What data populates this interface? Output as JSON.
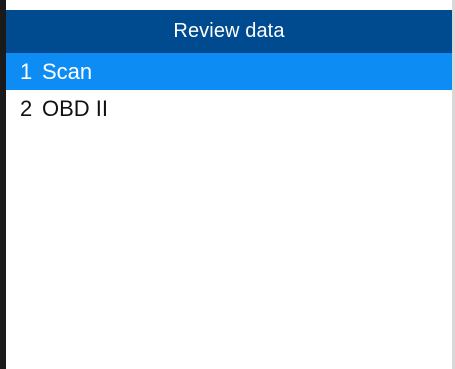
{
  "header": {
    "title": "Review data"
  },
  "menu": {
    "items": [
      {
        "number": "1",
        "label": "Scan",
        "selected": true
      },
      {
        "number": "2",
        "label": "OBD II",
        "selected": false
      }
    ]
  },
  "colors": {
    "title_bar": "#004a8f",
    "selection": "#0d8cf4",
    "text": "#111111",
    "background": "#ffffff"
  }
}
